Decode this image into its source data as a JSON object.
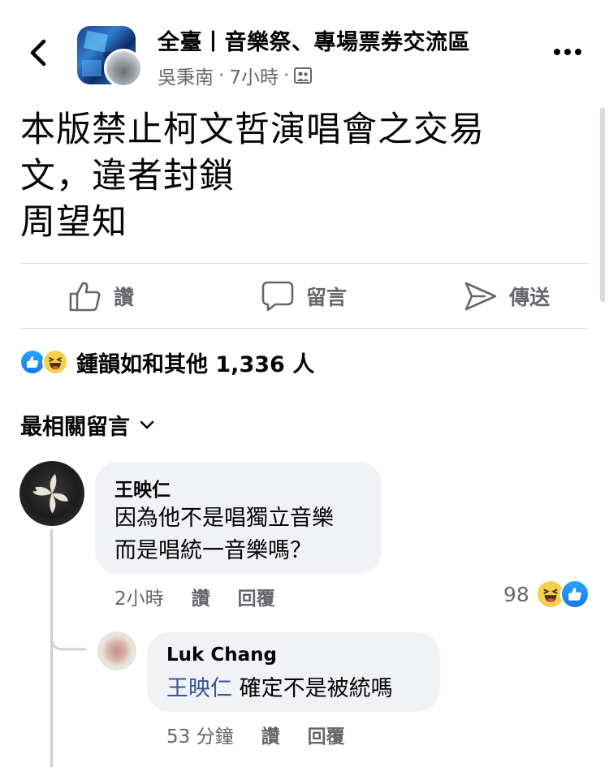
{
  "header": {
    "group_name": "全臺丨音樂祭、專場票券交流區",
    "author": "吳秉南",
    "time": "7小時",
    "separator": "·"
  },
  "post": {
    "lines": [
      "本版禁止柯文哲演唱會之交易",
      "文，違者封鎖",
      "周望知"
    ]
  },
  "actions": {
    "like": "讚",
    "comment": "留言",
    "share": "傳送"
  },
  "reactions": {
    "summary": "鍾韻如和其他 1,336 人"
  },
  "comments_section": {
    "sort_label": "最相關留言"
  },
  "comments": [
    {
      "name": "王映仁",
      "text_lines": [
        "因為他不是唱獨立音樂",
        "而是唱統一音樂嗎？"
      ],
      "time": "2小時",
      "like": "讚",
      "reply": "回覆",
      "reaction_count": "98"
    }
  ],
  "replies": [
    {
      "name": "Luk Chang",
      "mention": "王映仁",
      "text": "確定不是被統嗎",
      "time": "53 分鐘",
      "like": "讚",
      "reply": "回覆"
    }
  ],
  "colors": {
    "link_blue": "#385898",
    "like_blue": "#1877f2",
    "secondary": "#65676b",
    "bubble": "#f0f2f5"
  }
}
